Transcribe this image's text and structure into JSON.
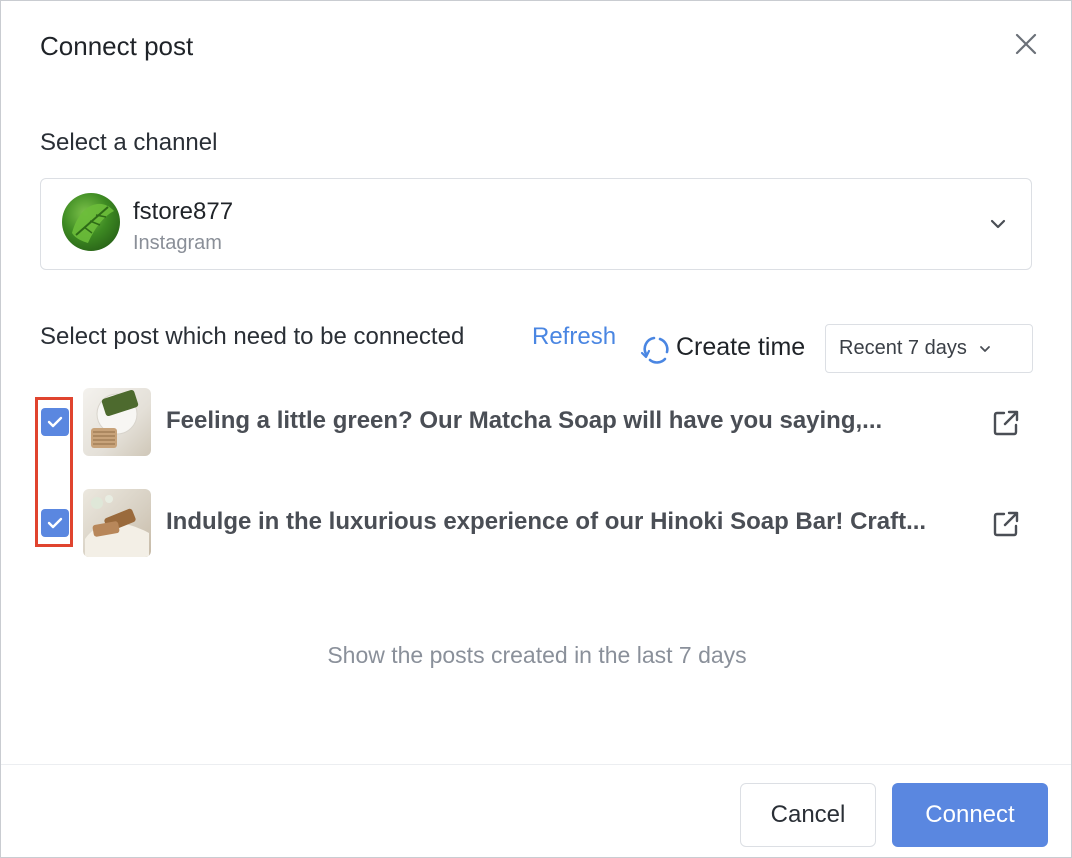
{
  "dialog": {
    "title": "Connect post",
    "close_icon": "close-icon"
  },
  "channel": {
    "section_label": "Select a channel",
    "name": "fstore877",
    "platform": "Instagram",
    "dropdown_icon": "chevron-down-icon"
  },
  "posts_section": {
    "label": "Select post which need to be connected",
    "refresh_label": "Refresh",
    "sort_icon": "refresh-cycle-icon",
    "sort_label": "Create time",
    "range_value": "Recent 7 days"
  },
  "posts": [
    {
      "checked": true,
      "text": "Feeling a little green? Our Matcha Soap will have you saying,...",
      "link_icon": "external-link-icon"
    },
    {
      "checked": true,
      "text": "Indulge in the luxurious experience of our Hinoki Soap Bar! Craft...",
      "link_icon": "external-link-icon"
    }
  ],
  "hint": "Show the posts created in the last 7 days",
  "footer": {
    "cancel_label": "Cancel",
    "connect_label": "Connect"
  },
  "colors": {
    "accent": "#5a87e0",
    "link": "#4a86e2",
    "highlight": "#e0442f"
  }
}
